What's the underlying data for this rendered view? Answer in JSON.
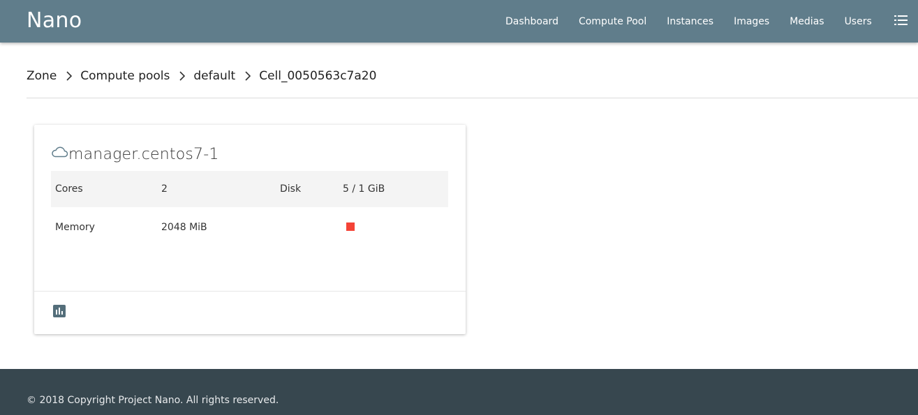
{
  "app": {
    "brand": "Nano"
  },
  "nav": {
    "links": [
      "Dashboard",
      "Compute Pool",
      "Instances",
      "Images",
      "Medias",
      "Users"
    ],
    "menu_icon": "list-menu-icon"
  },
  "breadcrumb": {
    "items": [
      "Zone",
      "Compute pools",
      "default",
      "Cell_0050563c7a20"
    ],
    "separator_icon": "chevron-right-icon"
  },
  "card": {
    "icon": "cloud-outline-icon",
    "title": "manager.centos7-1",
    "rows": [
      {
        "label1": "Cores",
        "value1": "2",
        "label2": "Disk",
        "value2": "5 / 1 GiB"
      },
      {
        "label1": "Memory",
        "value1": "2048 MiB",
        "label2": "",
        "value2": ""
      }
    ],
    "status_color": "#f44336",
    "footer_icon": "bar-chart-icon"
  },
  "footer": {
    "copyright": "© 2018 Copyright Project Nano. All rights reserved."
  },
  "colors": {
    "navbar": "#607d8b",
    "footer": "#37474f",
    "status_error": "#f44336",
    "icon_accent": "#546e7a"
  }
}
